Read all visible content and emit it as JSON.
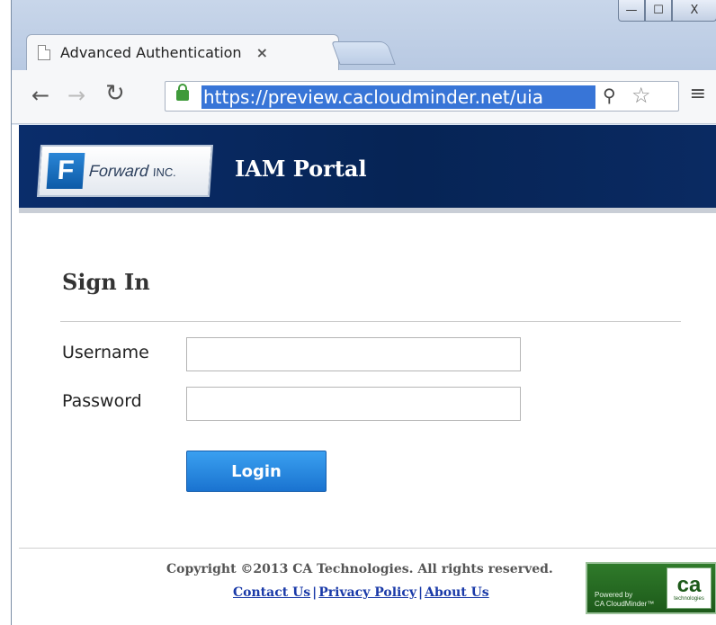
{
  "browser": {
    "tab_title": "Advanced Authentication",
    "tab_close": "×",
    "url": "https://preview.cacloudminder.net/uia",
    "window_controls": {
      "minimize": "—",
      "maximize": "☐",
      "close": "X"
    },
    "icons": {
      "back": "arrow-left-icon",
      "forward": "arrow-right-icon",
      "reload": "reload-icon",
      "lock": "lock-icon",
      "search": "search-icon",
      "star": "star-icon",
      "menu": "menu-icon"
    }
  },
  "header": {
    "logo_mark": "F",
    "logo_name": "Forward",
    "logo_suffix": "INC.",
    "portal_title": "IAM Portal"
  },
  "signin": {
    "title": "Sign In",
    "username_label": "Username",
    "username_value": "",
    "password_label": "Password",
    "password_value": "",
    "login_label": "Login"
  },
  "footer": {
    "copyright": "Copyright ©2013 CA Technologies. All rights reserved.",
    "links": [
      "Contact Us",
      "Privacy Policy",
      "About Us"
    ],
    "badge_powered_line1": "Powered by",
    "badge_powered_line2": "CA CloudMinder™",
    "badge_logo": "ca",
    "badge_logo_sub": "technologies"
  },
  "colors": {
    "header_bg": "#062455",
    "login_button": "#1a73d0",
    "link": "#1a3aa8",
    "badge_bg": "#2f7a2a"
  }
}
